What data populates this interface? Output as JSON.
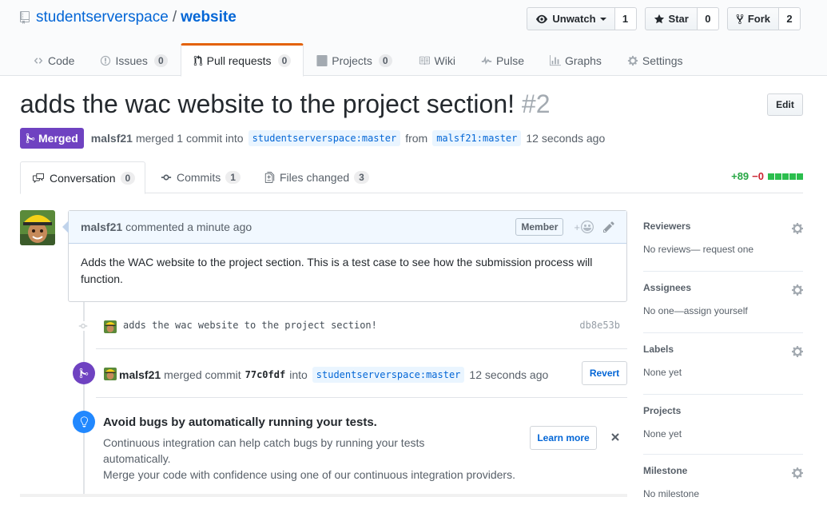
{
  "repo": {
    "owner": "studentserverspace",
    "separator": "/",
    "name": "website"
  },
  "header_actions": {
    "watch_label": "Unwatch",
    "watch_count": "1",
    "star_label": "Star",
    "star_count": "0",
    "fork_label": "Fork",
    "fork_count": "2"
  },
  "nav": {
    "code": "Code",
    "issues": "Issues",
    "issues_count": "0",
    "pull_requests": "Pull requests",
    "pull_requests_count": "0",
    "projects": "Projects",
    "projects_count": "0",
    "wiki": "Wiki",
    "pulse": "Pulse",
    "graphs": "Graphs",
    "settings": "Settings"
  },
  "pr": {
    "title": "adds the wac website to the project section!",
    "number": "#2",
    "edit_label": "Edit",
    "state": "Merged",
    "author": "malsf21",
    "merged_text": "merged 1 commit into",
    "base_owner": "studentserverspace",
    "base_branch": "master",
    "from_text": "from",
    "head_owner": "malsf21",
    "head_branch": "master",
    "time": "12 seconds ago"
  },
  "tabs": {
    "conversation": "Conversation",
    "conversation_count": "0",
    "commits": "Commits",
    "commits_count": "1",
    "files_changed": "Files changed",
    "files_changed_count": "3"
  },
  "diffstat": {
    "additions": "+89",
    "deletions": "−0"
  },
  "comment": {
    "author": "malsf21",
    "action": "commented",
    "time": "a minute ago",
    "role": "Member",
    "body": "Adds the WAC website to the project section. This is a test case to see how the submission process will function."
  },
  "commit": {
    "message": "adds the wac website to the project section!",
    "sha": "db8e53b"
  },
  "merge_event": {
    "author": "malsf21",
    "action": "merged commit",
    "sha": "77c0fdf",
    "into": "into",
    "base_owner": "studentserverspace",
    "base_branch": "master",
    "time": "12 seconds ago",
    "revert_label": "Revert"
  },
  "ci_prompt": {
    "title": "Avoid bugs by automatically running your tests.",
    "line1": "Continuous integration can help catch bugs by running your tests automatically.",
    "line2": "Merge your code with confidence using one of our continuous integration providers.",
    "learn_more": "Learn more"
  },
  "sidebar": {
    "reviewers_heading": "Reviewers",
    "reviewers_value": "No reviews— request one",
    "assignees_heading": "Assignees",
    "assignees_value": "No one—assign yourself",
    "labels_heading": "Labels",
    "labels_value": "None yet",
    "projects_heading": "Projects",
    "projects_value": "None yet",
    "milestone_heading": "Milestone",
    "milestone_value": "No milestone"
  },
  "colors": {
    "link": "#0366d6",
    "merged": "#6f42c1",
    "nav_accent": "#e36209",
    "additions": "#28a745",
    "deletions": "#cb2431",
    "ci_badge": "#2188ff"
  },
  "icons": {
    "repo": "repo-icon",
    "watch": "eye-icon",
    "star": "star-icon",
    "fork": "repo-forked-icon",
    "merge": "git-merge-icon",
    "commit": "git-commit-icon",
    "bulb": "light-bulb-icon",
    "gear": "gear-icon",
    "close": "x-icon"
  }
}
